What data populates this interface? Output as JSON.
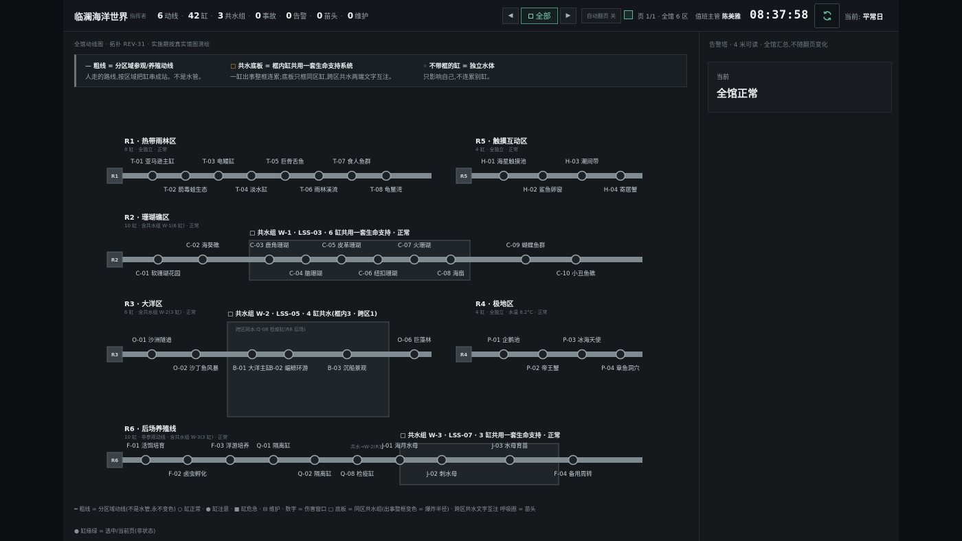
{
  "header": {
    "title": "临澜海洋世界",
    "subtitle": "指挥者",
    "stats": [
      {
        "value": "6",
        "label": "动线"
      },
      {
        "value": "42",
        "label": "缸"
      },
      {
        "value": "3",
        "label": "共水组"
      },
      {
        "value": "0",
        "label": "事故"
      },
      {
        "value": "0",
        "label": "告警"
      },
      {
        "value": "0",
        "label": "苗头"
      },
      {
        "value": "0",
        "label": "维护"
      }
    ],
    "prev_label": "◀",
    "all_label": "全部",
    "next_label": "▶",
    "auto_page_label": "自动翻页 关",
    "page_info": "页 1/1 · 全馆 6 区",
    "duty_label": "值班主管",
    "duty_name": "陈美雅",
    "clock": "08:37:58",
    "mode_label": "当前:",
    "mode_value": "平常日"
  },
  "main": {
    "heading": "全馆动线图 · 拓扑 REV-31 · 实施期按真实馆图测绘",
    "legend": [
      {
        "glyph": "—",
        "title": "粗线 = 分区域参观/养殖动线",
        "desc": "人走的路线,按区域把缸串成站。不是水管。"
      },
      {
        "glyph": "▢",
        "title": "共水底板 = 框内缸共用一套生命支持系统",
        "desc": "一缸出事整框连累;底板只框同区缸,跨区共水两端文字互注。"
      },
      {
        "glyph": "◦",
        "title": "不带框的缸 = 独立水体",
        "desc": "只影响自己,不连累别缸。"
      }
    ],
    "footer_line1": "━ 粗线 = 分区域动线(不是水管,永不变色)   ○ 缸正常 · ● 缸注意 · ■ 缸危急 · ⊟ 维护 · 数字 = 伤害窗口   ▢ 底板 = 同区共水组(出事整框变色 = 爆炸半径) · 跨区共水文字互注   呼吸圈 = 苗头",
    "footer_line2": "● 缸缘绿 = 选中/当前页(非状态)"
  },
  "chart_data": {
    "type": "diagram",
    "zones": [
      {
        "id": "R1",
        "title": "R1 · 热带雨林区",
        "meta": "8 缸 · 全独立 · 正常",
        "tanks": [
          {
            "label": "T-01 亚马逊主缸",
            "pos": "top"
          },
          {
            "label": "T-02 箭毒蛙生态",
            "pos": "bottom"
          },
          {
            "label": "T-03 电鳗缸",
            "pos": "top"
          },
          {
            "label": "T-04 淡水缸",
            "pos": "bottom"
          },
          {
            "label": "T-05 巨骨舌鱼",
            "pos": "top"
          },
          {
            "label": "T-06 雨林溪流",
            "pos": "bottom"
          },
          {
            "label": "T-07 食人鱼群",
            "pos": "top"
          },
          {
            "label": "T-08 龟鳖湾",
            "pos": "bottom"
          }
        ]
      },
      {
        "id": "R5",
        "title": "R5 · 触摸互动区",
        "meta": "4 缸 · 全独立 · 正常",
        "tanks": [
          {
            "label": "H-01 海星触摸池",
            "pos": "top"
          },
          {
            "label": "H-02 鲨鱼卵窗",
            "pos": "bottom"
          },
          {
            "label": "H-03 潮间带",
            "pos": "top"
          },
          {
            "label": "H-04 寄居蟹",
            "pos": "bottom"
          }
        ]
      },
      {
        "id": "R2",
        "title": "R2 · 珊瑚礁区",
        "meta": "10 缸 · 含共水组 W-1(6 缸) · 正常",
        "group": "▢ 共水组 W-1 · LSS-03 · 6 缸共用一套生命支持 · 正常",
        "tanks": [
          {
            "label": "C-01 软珊瑚花园",
            "pos": "bottom"
          },
          {
            "label": "C-02 海葵礁",
            "pos": "top"
          },
          {
            "label": "C-03 鹿角珊瑚",
            "pos": "top"
          },
          {
            "label": "C-04 脑珊瑚",
            "pos": "bottom"
          },
          {
            "label": "C-05 皮革珊瑚",
            "pos": "top"
          },
          {
            "label": "C-06 纽扣珊瑚",
            "pos": "bottom"
          },
          {
            "label": "C-07 火珊瑚",
            "pos": "top"
          },
          {
            "label": "C-08 海扇",
            "pos": "bottom"
          },
          {
            "label": "C-09 蝴蝶鱼群",
            "pos": "top"
          },
          {
            "label": "C-10 小丑鱼礁",
            "pos": "bottom"
          }
        ]
      },
      {
        "id": "R3",
        "title": "R3 · 大洋区",
        "meta": "6 缸 · 含共水组 W-2(3 缸) · 正常",
        "group": "▢ 共水组 W-2 · LSS-05 · 4 缸共水(框内3 · 跨区1)",
        "group_note": "跨区同水:Q-08 检疫缸(R6 后场)",
        "tanks": [
          {
            "label": "O-01 沙洲隧道",
            "pos": "top"
          },
          {
            "label": "O-02 沙丁鱼风暴",
            "pos": "bottom"
          },
          {
            "label": "B-01 大洋主缸",
            "pos": "bottom"
          },
          {
            "label": "B-02 蝠鲼环游",
            "pos": "bottom"
          },
          {
            "label": "B-03 沉船景观",
            "pos": "bottom"
          },
          {
            "label": "O-06 巨藻林",
            "pos": "top"
          }
        ]
      },
      {
        "id": "R4",
        "title": "R4 · 极地区",
        "meta": "4 缸 · 全独立 · 水温 8.2°C · 正常",
        "tanks": [
          {
            "label": "P-01 企鹅池",
            "pos": "top"
          },
          {
            "label": "P-02 帝王蟹",
            "pos": "bottom"
          },
          {
            "label": "P-03 冰海天使",
            "pos": "top"
          },
          {
            "label": "P-04 章鱼洞穴",
            "pos": "bottom"
          }
        ]
      },
      {
        "id": "R6",
        "title": "R6 · 后场养殖线",
        "meta": "10 缸 · 非参观动线 · 含共水组 W-3(3 缸) · 正常",
        "group": "▢ 共水组 W-3 · LSS-07 · 3 缸共用一套生命支持 · 正常",
        "cross_note": "共水→W-2(R3)",
        "tanks": [
          {
            "label": "F-01 活饵培育",
            "pos": "top"
          },
          {
            "label": "F-02 卤虫孵化",
            "pos": "bottom"
          },
          {
            "label": "F-03 浮游培养",
            "pos": "top"
          },
          {
            "label": "Q-01 隔离缸",
            "pos": "top"
          },
          {
            "label": "Q-02 隔离缸",
            "pos": "bottom"
          },
          {
            "label": "Q-08 检疫缸",
            "pos": "bottom"
          },
          {
            "label": "J-01 海月水母",
            "pos": "top"
          },
          {
            "label": "J-02 刺水母",
            "pos": "bottom"
          },
          {
            "label": "J-03 水母育苗",
            "pos": "top"
          },
          {
            "label": "F-04 备用周转",
            "pos": "bottom"
          }
        ]
      }
    ]
  },
  "side": {
    "header": "告警塔 · 4 米可读 · 全馆汇总,不随翻页变化",
    "current_label": "当前",
    "current_value": "全馆正常"
  },
  "colors": {
    "accent": "#5fb59c",
    "line": "#7f8b91",
    "node_fill": "#1d2226",
    "node_stroke": "#9aa4aa",
    "group_fill": "#1f2528"
  }
}
